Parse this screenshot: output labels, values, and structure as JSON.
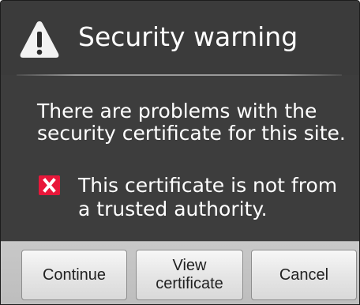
{
  "dialog": {
    "title": "Security warning",
    "icon": "warning-icon",
    "message": "There are problems with the security certificate for this site.",
    "error_item": {
      "icon": "error-x-icon",
      "text": "This certificate is not from a trusted authority."
    }
  },
  "buttons": {
    "continue_label": "Continue",
    "view_label_line1": "View",
    "view_label_line2": "certificate",
    "cancel_label": "Cancel"
  },
  "colors": {
    "dialog_background": "#3d3d3d",
    "error_icon": "#e8173a",
    "button_bar": "#c4c4c4"
  }
}
